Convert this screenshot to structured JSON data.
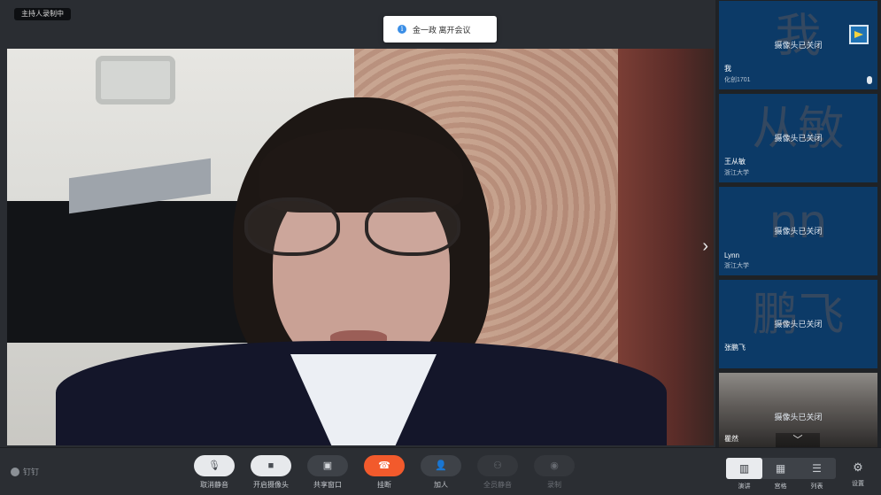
{
  "recording_badge": "主持人录制中",
  "toast": {
    "icon": "i",
    "text": "金一政 离开会议"
  },
  "participants": [
    {
      "big_label": "我",
      "status": "摄像头已关闭",
      "name": "我",
      "org": "化创1701"
    },
    {
      "big_label": "从敏",
      "status": "摄像头已关闭",
      "name": "王从敏",
      "org": "浙江大学"
    },
    {
      "big_label": "nn",
      "status": "摄像头已关闭",
      "name": "Lynn",
      "org": "浙江大学"
    },
    {
      "big_label": "鹏飞",
      "status": "摄像头已关闭",
      "name": "张鹏飞",
      "org": ""
    },
    {
      "big_label": "",
      "status": "摄像头已关闭",
      "name": "瞿然",
      "org": ""
    }
  ],
  "toolbar": {
    "brand": "钉钉",
    "mute": "取消静音",
    "camera": "开启摄像头",
    "share": "共享窗口",
    "hangup": "挂断",
    "invite": "加人",
    "mute_all": "全员静音",
    "record": "录制",
    "view_speaker": "演讲",
    "view_gallery": "宫格",
    "view_list": "列表",
    "settings": "设置"
  },
  "icons": {
    "mic": "mic-off-icon",
    "camera": "camera-off-icon",
    "share": "share-screen-icon",
    "hangup": "hangup-icon",
    "invite": "add-person-icon",
    "mute_all": "mute-all-icon",
    "record": "record-icon",
    "settings": "gear-icon"
  },
  "colors": {
    "hangup": "#f25a2c",
    "tile_bg": "#0c3a67",
    "info": "#3a8ee6"
  }
}
